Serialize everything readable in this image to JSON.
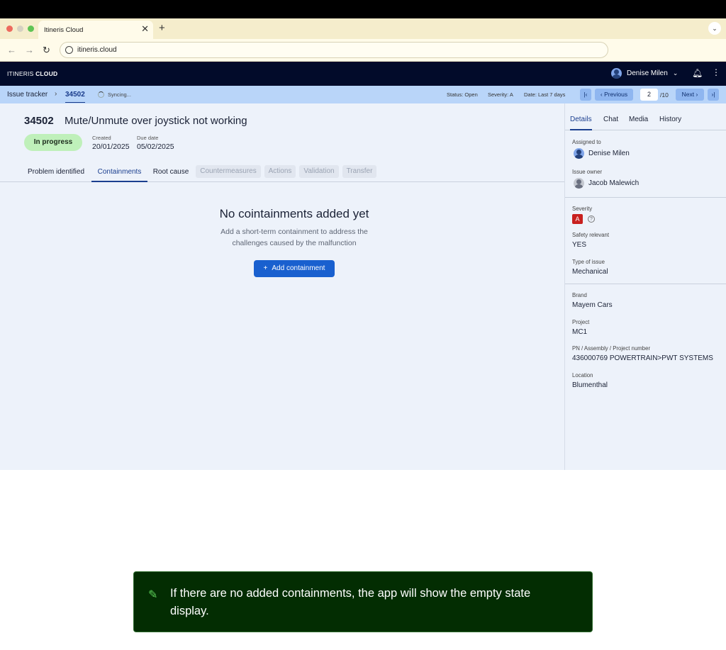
{
  "browser": {
    "tab_title": "Itineris Cloud",
    "tab_close": "✕",
    "new_tab": "+",
    "url": "itineris.cloud"
  },
  "appbar": {
    "brand_light": "ITINERIS",
    "brand_bold": "CLOUD",
    "user_name": "Denise Milen"
  },
  "crumbs": {
    "root": "Issue tracker",
    "current": "34502",
    "sync": "Syncing..."
  },
  "filters": {
    "status": "Status: Open",
    "severity": "Severity: A",
    "date": "Date: Last 7 days"
  },
  "pager": {
    "previous": "Previous",
    "current": "2",
    "total": "/10",
    "next": "Next"
  },
  "issue": {
    "id": "34502",
    "title": "Mute/Unmute over joystick not working",
    "status": "In progress",
    "created_label": "Created",
    "created": "20/01/2025",
    "due_label": "Due date",
    "due": "05/02/2025"
  },
  "process_tabs": [
    "Problem identified",
    "Containments",
    "Root cause",
    "Countermeasures",
    "Actions",
    "Validation",
    "Transfer"
  ],
  "empty": {
    "title": "No cointainments added yet",
    "description": "Add a short-term containment to address the challenges caused by the malfunction",
    "button": "Add containment"
  },
  "side_tabs": [
    "Details",
    "Chat",
    "Media",
    "History"
  ],
  "details": {
    "assigned_label": "Assigned to",
    "assigned": "Denise Milen",
    "owner_label": "Issue owner",
    "owner": "Jacob Malewich",
    "severity_label": "Severity",
    "severity": "A",
    "safety_label": "Safety relevant",
    "safety": "YES",
    "type_label": "Type of issue",
    "type": "Mechanical",
    "brand_label": "Brand",
    "brand": "Mayem Cars",
    "project_label": "Project",
    "project": "MC1",
    "pn_label": "PN / Assembly / Project number",
    "pn": "436000769 POWERTRAIN>PWT SYSTEMS",
    "location_label": "Location",
    "location": "Blumenthal"
  },
  "note": "If there are no added containments, the app will show the empty state display.",
  "colors": {
    "appbar": "#020b2a",
    "crumbbar": "#b9d5f9",
    "primary": "#1960cf",
    "status_pill": "#bff0ba",
    "severity_a": "#c8201f",
    "note_bg": "#032d02"
  }
}
